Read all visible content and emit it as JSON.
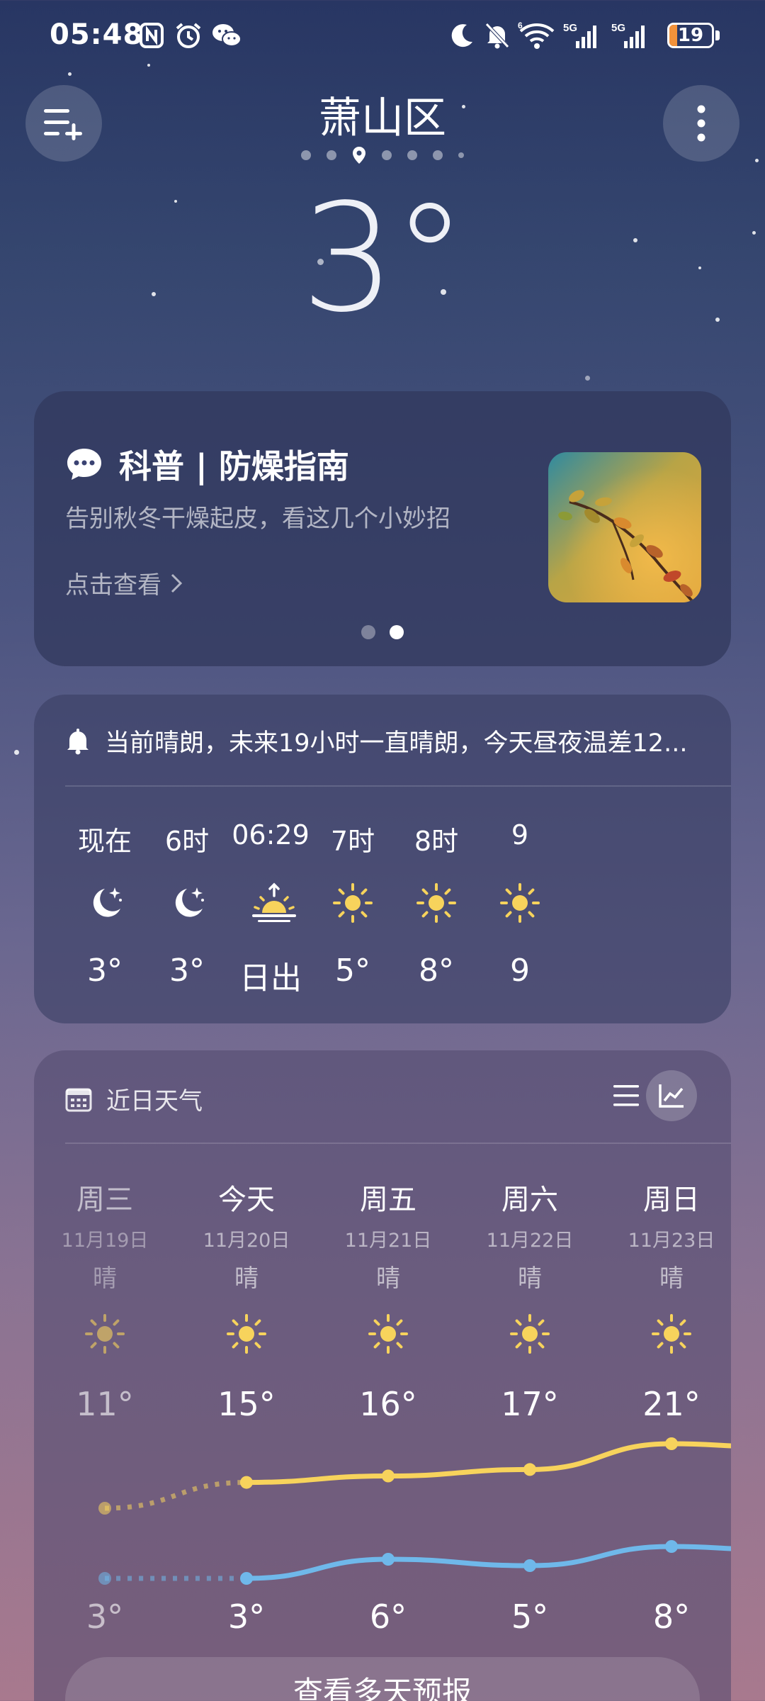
{
  "status_bar": {
    "time": "05:48",
    "battery": 19,
    "battery_color": "#f3923a",
    "signal_1": "5G",
    "signal_2": "5G",
    "wifi_badge": "6",
    "left_icons": [
      "nfc-icon",
      "alarm-icon",
      "wechat-icon"
    ],
    "right_icons": [
      "moon-dnd-icon",
      "bell-off-icon",
      "wifi-icon",
      "signal-icon",
      "signal-icon",
      "battery-icon"
    ]
  },
  "header": {
    "city": "萧山区",
    "current_temp": "3°",
    "left_button_icon": "city-list-add-icon",
    "right_button_icon": "more-vertical-icon"
  },
  "news_card": {
    "title": "科普 | 防燥指南",
    "subtitle": "告别秋冬干燥起皮，看这几个小妙招",
    "link": "点击查看",
    "icon": "chat-bubble-icon",
    "image": "autumn-branch-photo",
    "active_slide": 2,
    "slide_count": 2
  },
  "hourly": {
    "alert": "当前晴朗，未来19小时一直晴朗，今天昼夜温差12...",
    "alert_icon": "bell-icon",
    "items": [
      {
        "time": "现在",
        "icon": "moon-stars-icon",
        "temp": "3°"
      },
      {
        "time": "6时",
        "icon": "moon-stars-icon",
        "temp": "3°"
      },
      {
        "time": "06:29",
        "icon": "sunrise-icon",
        "temp": "日出"
      },
      {
        "time": "7时",
        "icon": "sun-icon",
        "temp": "5°"
      },
      {
        "time": "8时",
        "icon": "sun-icon",
        "temp": "8°"
      },
      {
        "time": "9",
        "icon": "sun-icon",
        "temp": "9"
      }
    ]
  },
  "daily": {
    "title": "近日天气",
    "title_icon": "calendar-icon",
    "toggle_list_icon": "list-view-icon",
    "toggle_chart_icon": "chart-view-icon",
    "days": [
      {
        "name": "周三",
        "date": "11月19日",
        "cond": "晴",
        "icon": "sun-icon",
        "high": "11°",
        "low": "3°",
        "high_value": 11,
        "low_value": 3,
        "past": true
      },
      {
        "name": "今天",
        "date": "11月20日",
        "cond": "晴",
        "icon": "sun-icon",
        "high": "15°",
        "low": "3°",
        "high_value": 15,
        "low_value": 3,
        "past": false
      },
      {
        "name": "周五",
        "date": "11月21日",
        "cond": "晴",
        "icon": "sun-icon",
        "high": "16°",
        "low": "6°",
        "high_value": 16,
        "low_value": 6,
        "past": false
      },
      {
        "name": "周六",
        "date": "11月22日",
        "cond": "晴",
        "icon": "sun-icon",
        "high": "17°",
        "low": "5°",
        "high_value": 17,
        "low_value": 5,
        "past": false
      },
      {
        "name": "周日",
        "date": "11月23日",
        "cond": "晴",
        "icon": "sun-icon",
        "high": "21°",
        "low": "8°",
        "high_value": 21,
        "low_value": 8,
        "past": false
      }
    ],
    "high_color": "#f7d35c",
    "low_color": "#6fb8ea",
    "more_button": "查看多天预报"
  }
}
